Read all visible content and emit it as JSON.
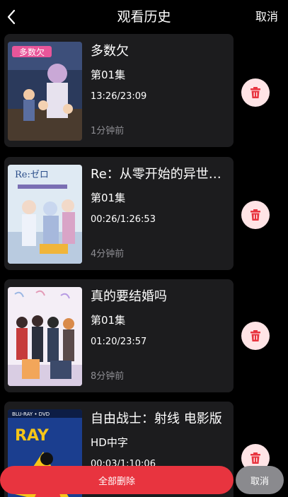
{
  "header": {
    "title": "观看历史",
    "cancel_label": "取消",
    "back_icon": "chevron-left-icon"
  },
  "history": [
    {
      "title": "多数欠",
      "episode": "第01集",
      "progress": "13:26/23:09",
      "time_ago": "1分钟前",
      "delete_icon": "trash-icon"
    },
    {
      "title": "Re：从零开始的异世界生活",
      "episode": "第01集",
      "progress": "00:26/1:26:53",
      "time_ago": "4分钟前",
      "delete_icon": "trash-icon"
    },
    {
      "title": "真的要结婚吗",
      "episode": "第01集",
      "progress": "01:20/23:57",
      "time_ago": "8分钟前",
      "delete_icon": "trash-icon"
    },
    {
      "title": "自由战士：射线 电影版",
      "episode": "HD中字",
      "progress": "00:03/1:10:06",
      "time_ago": "",
      "delete_icon": "trash-icon"
    }
  ],
  "footer": {
    "delete_all_label": "全部删除",
    "cancel_label": "取消"
  },
  "colors": {
    "background": "#000000",
    "card": "#1c1c1e",
    "accent_red": "#e8343f",
    "delete_bg": "#ffe4e6",
    "delete_icon": "#e8343f",
    "muted_text": "#8e8e93",
    "cancel_gray": "#8a8a8e"
  }
}
